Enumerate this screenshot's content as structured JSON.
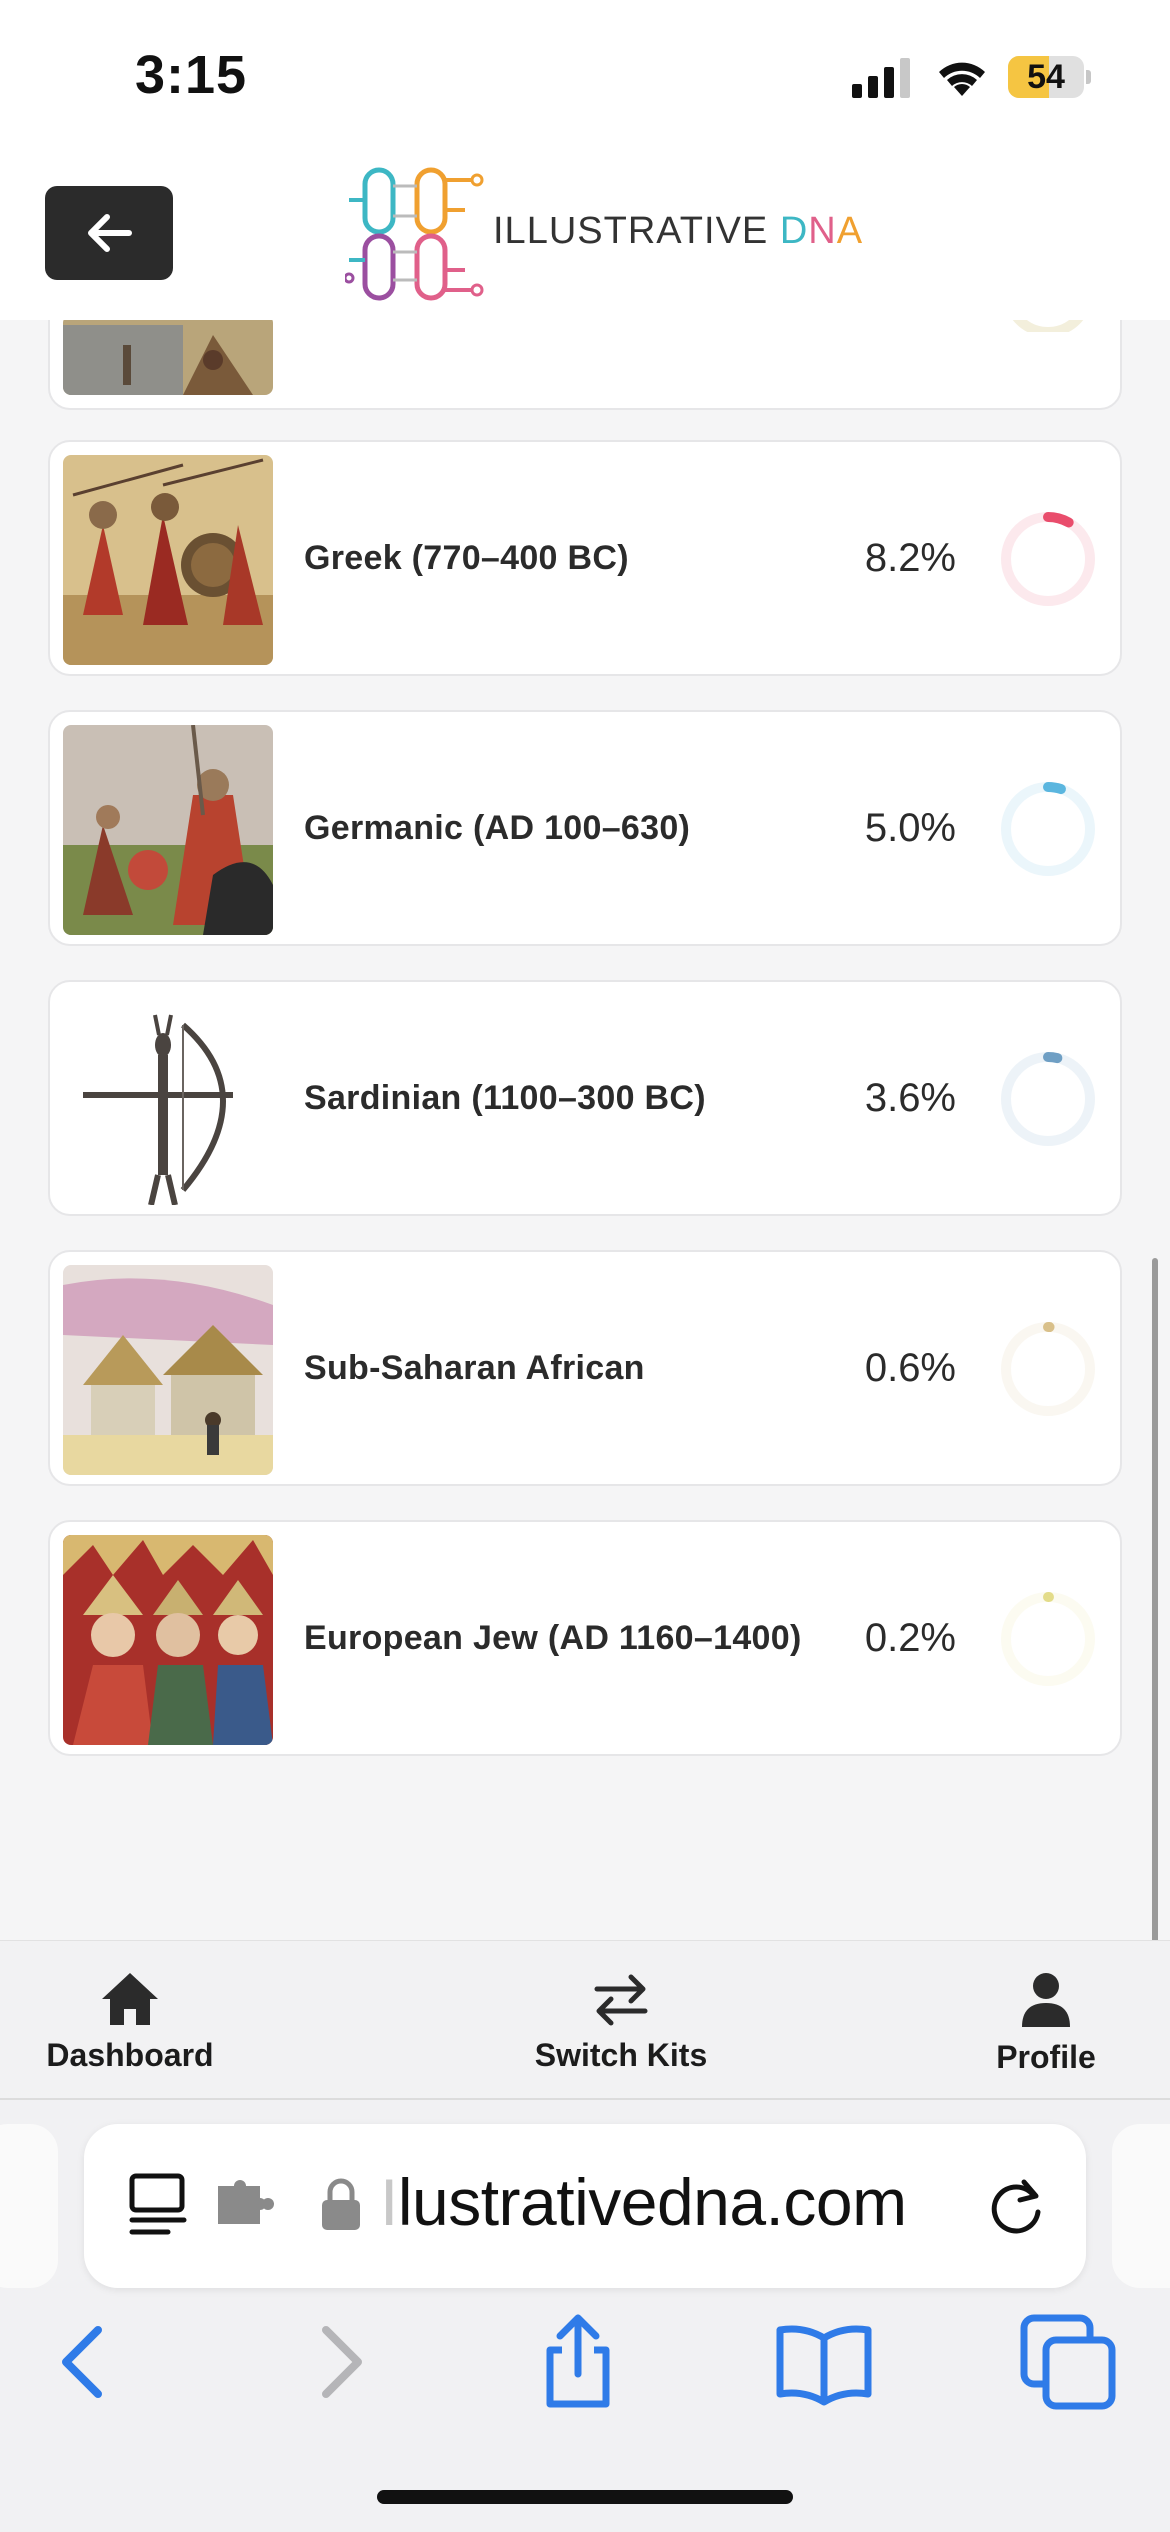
{
  "status_bar": {
    "time": "3:15",
    "battery": "54",
    "battery_fraction": 0.54
  },
  "header": {
    "logo_text_main": "ILLUSTRATIVE ",
    "logo_text_dna": [
      "D",
      "N",
      "A"
    ]
  },
  "populations": [
    {
      "name": "",
      "percent": "",
      "fraction": 0.01,
      "color": "#f0e8c8",
      "image": "battle-scene"
    },
    {
      "name": "Greek (770–400 BC)",
      "percent": "8.2%",
      "fraction": 0.082,
      "color": "#e94d6c",
      "image": "greek-hoplites"
    },
    {
      "name": "Germanic (AD 100–630)",
      "percent": "5.0%",
      "fraction": 0.05,
      "color": "#5bb6df",
      "image": "germanic-warriors"
    },
    {
      "name": "Sardinian (1100–300 BC)",
      "percent": "3.6%",
      "fraction": 0.036,
      "color": "#6f9fc4",
      "image": "nuragic-archer-bronze"
    },
    {
      "name": "Sub-Saharan African",
      "percent": "0.6%",
      "fraction": 0.006,
      "color": "#d9c08a",
      "image": "african-village"
    },
    {
      "name": "European Jew (AD 1160–1400)",
      "percent": "0.2%",
      "fraction": 0.002,
      "color": "#e3dc8a",
      "image": "medieval-manuscript"
    }
  ],
  "bottom_nav": {
    "dashboard": "Dashboard",
    "switch_kits": "Switch Kits",
    "profile": "Profile"
  },
  "browser": {
    "url_faded": "I",
    "url": "lustrativedna.com"
  },
  "icons": {
    "back": "arrow-left-icon",
    "home": "home-icon",
    "switch": "swap-arrows-icon",
    "profile": "person-icon",
    "reader": "reader-icon",
    "extension": "extension-icon",
    "lock": "lock-icon",
    "reload": "reload-icon",
    "nav_back": "chevron-left-icon",
    "nav_forward": "chevron-right-icon",
    "share": "share-icon",
    "bookmarks": "book-icon",
    "tabs": "tabs-icon"
  }
}
